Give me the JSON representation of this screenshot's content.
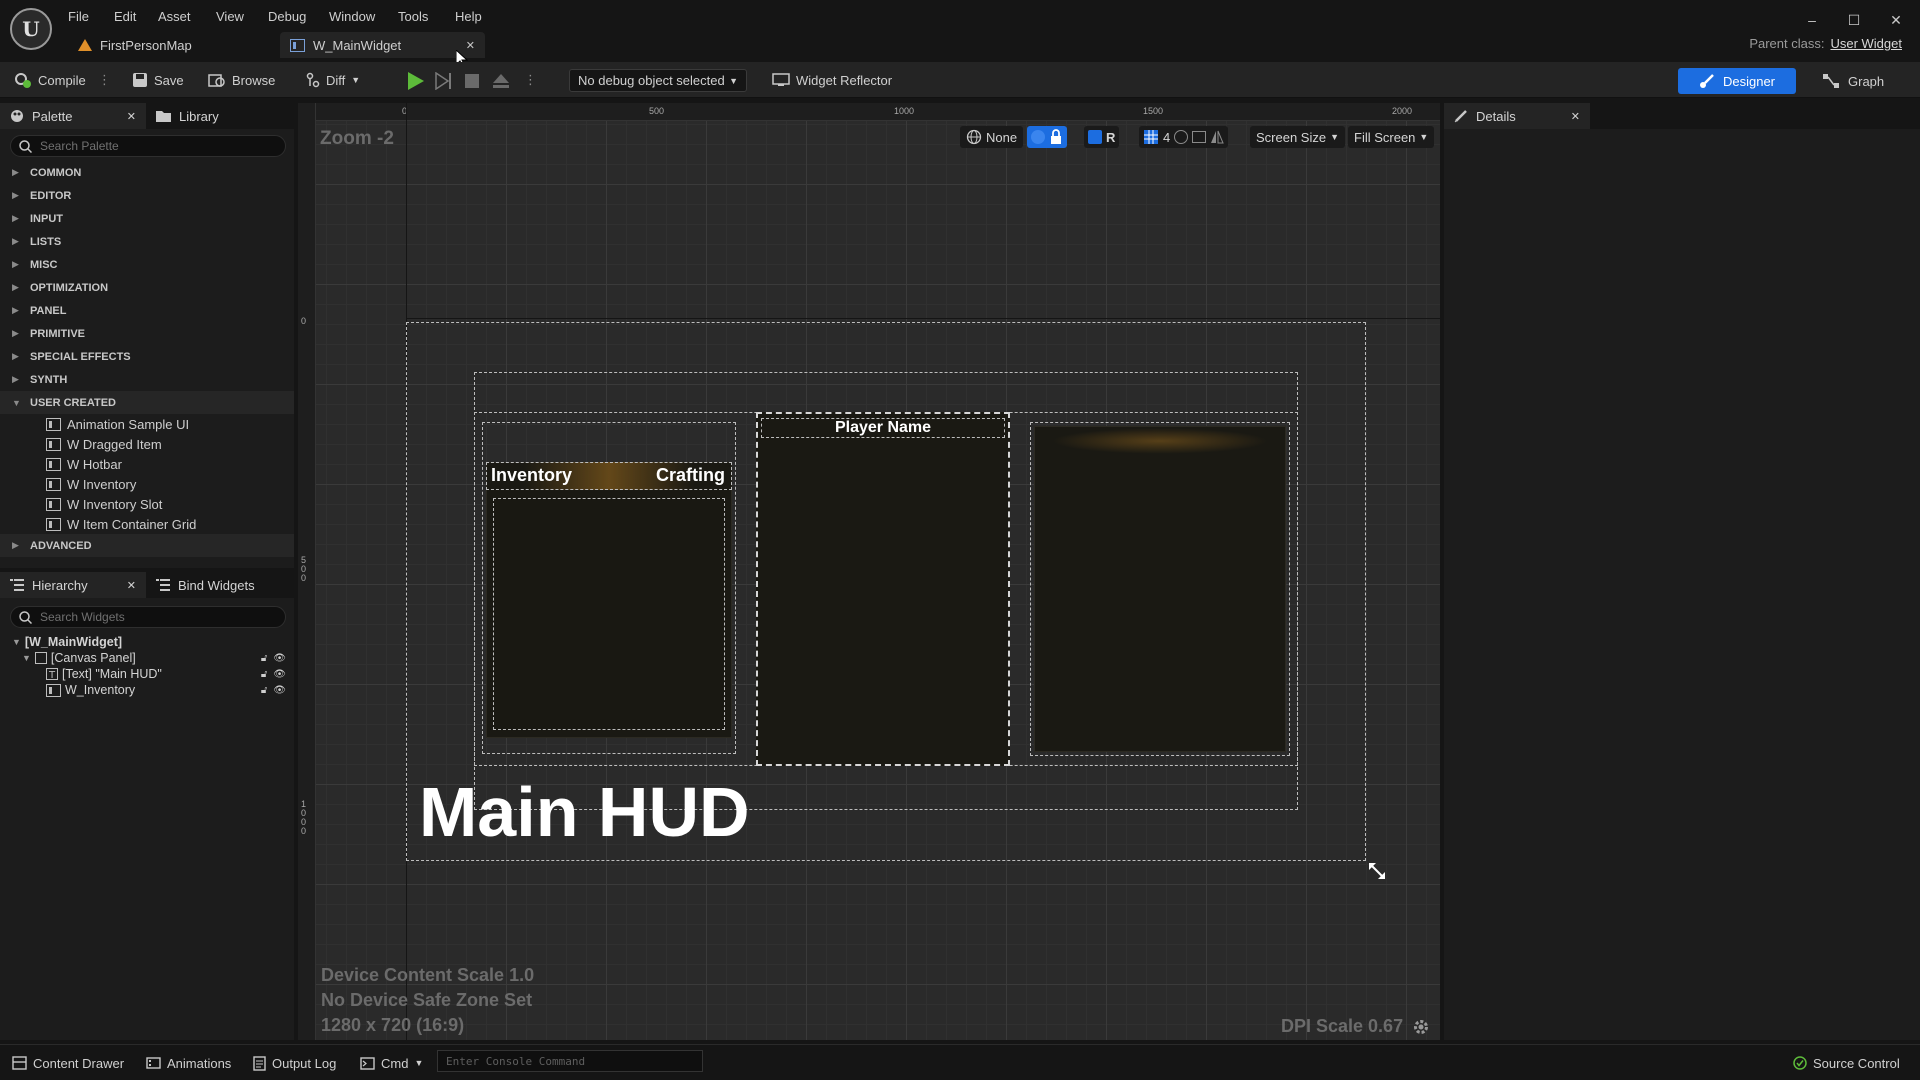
{
  "menu": [
    "File",
    "Edit",
    "Asset",
    "View",
    "Debug",
    "Window",
    "Tools",
    "Help"
  ],
  "tabs": [
    {
      "label": "FirstPersonMap",
      "icon": "level-icon"
    },
    {
      "label": "W_MainWidget",
      "icon": "widget-blueprint-icon"
    }
  ],
  "window_controls": {
    "minimize": "–",
    "maximize": "☐",
    "close": "✕"
  },
  "parent_class": {
    "label": "Parent class:",
    "value": "User Widget"
  },
  "toolbar": {
    "compile": "Compile",
    "save": "Save",
    "browse": "Browse",
    "diff": "Diff",
    "debug_object": "No debug object selected",
    "widget_reflector": "Widget Reflector",
    "designer": "Designer",
    "graph": "Graph"
  },
  "palette": {
    "tab": "Palette",
    "library_tab": "Library",
    "search_placeholder": "Search Palette",
    "categories": [
      "COMMON",
      "EDITOR",
      "INPUT",
      "LISTS",
      "MISC",
      "OPTIMIZATION",
      "PANEL",
      "PRIMITIVE",
      "SPECIAL EFFECTS",
      "SYNTH"
    ],
    "user_created": {
      "label": "USER CREATED",
      "items": [
        "Animation Sample UI",
        "W Dragged Item",
        "W Hotbar",
        "W Inventory",
        "W Inventory Slot",
        "W Item Container Grid"
      ]
    },
    "advanced": "ADVANCED"
  },
  "hierarchy": {
    "tab": "Hierarchy",
    "bind_tab": "Bind Widgets",
    "search_placeholder": "Search Widgets",
    "root": "[W_MainWidget]",
    "canvas": "[Canvas Panel]",
    "text_item": "[Text] \"Main HUD\"",
    "inventory_item": "W_Inventory"
  },
  "viewport": {
    "zoom": "Zoom -2",
    "ruler_top": [
      "0",
      "500",
      "1000",
      "1500",
      "2000"
    ],
    "ruler_left": [
      "0",
      "5\n0\n0",
      "1\n0\n0\n0"
    ],
    "toolbar": {
      "none": "None",
      "r": "R",
      "grid_count": "4",
      "screen_size": "Screen Size",
      "fill_screen": "Fill Screen"
    },
    "device_content_scale": "Device Content Scale 1.0",
    "safe_zone": "No Device Safe Zone Set",
    "resolution": "1280 x 720 (16:9)",
    "dpi_scale": "DPI Scale 0.67",
    "widget": {
      "inventory_title": "Inventory",
      "crafting_title": "Crafting",
      "player_name": "Player Name",
      "main_hud": "Main HUD"
    }
  },
  "details": {
    "tab": "Details"
  },
  "statusbar": {
    "content_drawer": "Content Drawer",
    "animations": "Animations",
    "output_log": "Output Log",
    "cmd": "Cmd",
    "console_placeholder": "Enter Console Command",
    "source_control": "Source Control"
  },
  "colors": {
    "accent": "#1c6de0",
    "play": "#5dbb3a",
    "panel": "#1a1913"
  }
}
